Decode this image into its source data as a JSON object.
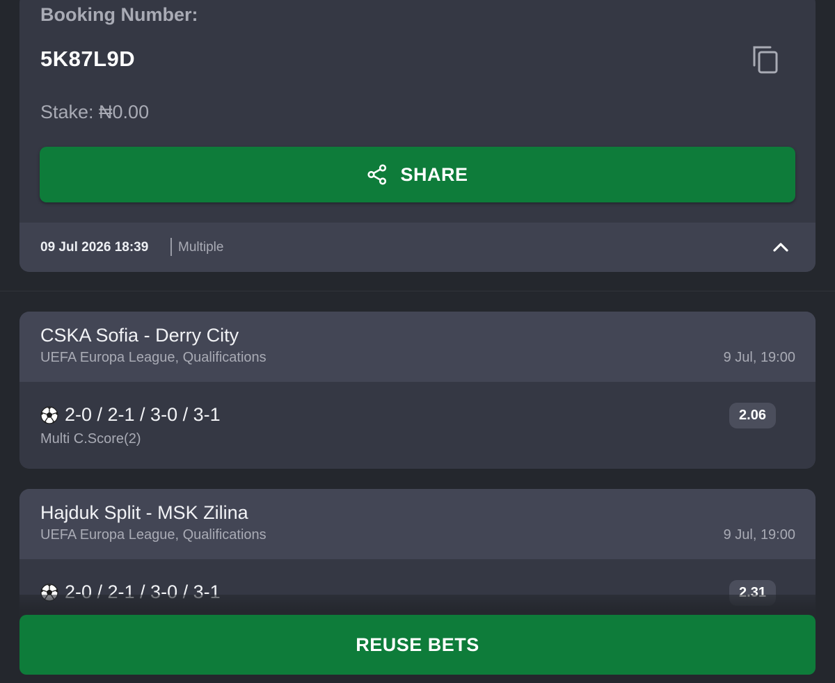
{
  "booking": {
    "label": "Booking Number:",
    "code": "5K87L9D",
    "copy_icon": "copy-icon",
    "stake": "Stake: ₦0.00",
    "share_label": "SHARE",
    "share_icon": "share-icon",
    "datetime": "09 Jul 2026 18:39",
    "bet_type": "Multiple",
    "collapse_icon": "chevron-up-icon"
  },
  "matches": [
    {
      "title": "CSKA Sofia - Derry City",
      "league": "UEFA Europa League, Qualifications",
      "time": "9 Jul, 19:00",
      "sport_icon": "soccer-ball-icon",
      "pick": "2-0 / 2-1 / 3-0 / 3-1",
      "market": "Multi C.Score(2)",
      "odds": "2.06"
    },
    {
      "title": "Hajduk Split - MSK Zilina",
      "league": "UEFA Europa League, Qualifications",
      "time": "9 Jul, 19:00",
      "sport_icon": "soccer-ball-icon",
      "pick": "2-0 / 2-1 / 3-0 / 3-1",
      "odds": "2.31"
    }
  ],
  "reuse_label": "REUSE BETS",
  "colors": {
    "background": "#24272d",
    "card": "#353844",
    "card_header": "#434655",
    "accent_green": "#0e7c3a",
    "odds_badge": "#4b4e5c"
  }
}
